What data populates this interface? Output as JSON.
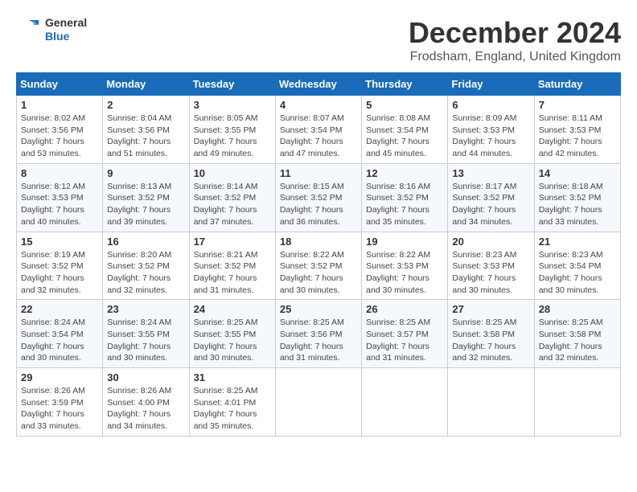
{
  "logo": {
    "text_general": "General",
    "text_blue": "Blue"
  },
  "header": {
    "month": "December 2024",
    "location": "Frodsham, England, United Kingdom"
  },
  "weekdays": [
    "Sunday",
    "Monday",
    "Tuesday",
    "Wednesday",
    "Thursday",
    "Friday",
    "Saturday"
  ],
  "weeks": [
    [
      {
        "day": "1",
        "sunrise": "8:02 AM",
        "sunset": "3:56 PM",
        "daylight": "7 hours and 53 minutes."
      },
      {
        "day": "2",
        "sunrise": "8:04 AM",
        "sunset": "3:56 PM",
        "daylight": "7 hours and 51 minutes."
      },
      {
        "day": "3",
        "sunrise": "8:05 AM",
        "sunset": "3:55 PM",
        "daylight": "7 hours and 49 minutes."
      },
      {
        "day": "4",
        "sunrise": "8:07 AM",
        "sunset": "3:54 PM",
        "daylight": "7 hours and 47 minutes."
      },
      {
        "day": "5",
        "sunrise": "8:08 AM",
        "sunset": "3:54 PM",
        "daylight": "7 hours and 45 minutes."
      },
      {
        "day": "6",
        "sunrise": "8:09 AM",
        "sunset": "3:53 PM",
        "daylight": "7 hours and 44 minutes."
      },
      {
        "day": "7",
        "sunrise": "8:11 AM",
        "sunset": "3:53 PM",
        "daylight": "7 hours and 42 minutes."
      }
    ],
    [
      {
        "day": "8",
        "sunrise": "8:12 AM",
        "sunset": "3:53 PM",
        "daylight": "7 hours and 40 minutes."
      },
      {
        "day": "9",
        "sunrise": "8:13 AM",
        "sunset": "3:52 PM",
        "daylight": "7 hours and 39 minutes."
      },
      {
        "day": "10",
        "sunrise": "8:14 AM",
        "sunset": "3:52 PM",
        "daylight": "7 hours and 37 minutes."
      },
      {
        "day": "11",
        "sunrise": "8:15 AM",
        "sunset": "3:52 PM",
        "daylight": "7 hours and 36 minutes."
      },
      {
        "day": "12",
        "sunrise": "8:16 AM",
        "sunset": "3:52 PM",
        "daylight": "7 hours and 35 minutes."
      },
      {
        "day": "13",
        "sunrise": "8:17 AM",
        "sunset": "3:52 PM",
        "daylight": "7 hours and 34 minutes."
      },
      {
        "day": "14",
        "sunrise": "8:18 AM",
        "sunset": "3:52 PM",
        "daylight": "7 hours and 33 minutes."
      }
    ],
    [
      {
        "day": "15",
        "sunrise": "8:19 AM",
        "sunset": "3:52 PM",
        "daylight": "7 hours and 32 minutes."
      },
      {
        "day": "16",
        "sunrise": "8:20 AM",
        "sunset": "3:52 PM",
        "daylight": "7 hours and 32 minutes."
      },
      {
        "day": "17",
        "sunrise": "8:21 AM",
        "sunset": "3:52 PM",
        "daylight": "7 hours and 31 minutes."
      },
      {
        "day": "18",
        "sunrise": "8:22 AM",
        "sunset": "3:52 PM",
        "daylight": "7 hours and 30 minutes."
      },
      {
        "day": "19",
        "sunrise": "8:22 AM",
        "sunset": "3:53 PM",
        "daylight": "7 hours and 30 minutes."
      },
      {
        "day": "20",
        "sunrise": "8:23 AM",
        "sunset": "3:53 PM",
        "daylight": "7 hours and 30 minutes."
      },
      {
        "day": "21",
        "sunrise": "8:23 AM",
        "sunset": "3:54 PM",
        "daylight": "7 hours and 30 minutes."
      }
    ],
    [
      {
        "day": "22",
        "sunrise": "8:24 AM",
        "sunset": "3:54 PM",
        "daylight": "7 hours and 30 minutes."
      },
      {
        "day": "23",
        "sunrise": "8:24 AM",
        "sunset": "3:55 PM",
        "daylight": "7 hours and 30 minutes."
      },
      {
        "day": "24",
        "sunrise": "8:25 AM",
        "sunset": "3:55 PM",
        "daylight": "7 hours and 30 minutes."
      },
      {
        "day": "25",
        "sunrise": "8:25 AM",
        "sunset": "3:56 PM",
        "daylight": "7 hours and 31 minutes."
      },
      {
        "day": "26",
        "sunrise": "8:25 AM",
        "sunset": "3:57 PM",
        "daylight": "7 hours and 31 minutes."
      },
      {
        "day": "27",
        "sunrise": "8:25 AM",
        "sunset": "3:58 PM",
        "daylight": "7 hours and 32 minutes."
      },
      {
        "day": "28",
        "sunrise": "8:25 AM",
        "sunset": "3:58 PM",
        "daylight": "7 hours and 32 minutes."
      }
    ],
    [
      {
        "day": "29",
        "sunrise": "8:26 AM",
        "sunset": "3:59 PM",
        "daylight": "7 hours and 33 minutes."
      },
      {
        "day": "30",
        "sunrise": "8:26 AM",
        "sunset": "4:00 PM",
        "daylight": "7 hours and 34 minutes."
      },
      {
        "day": "31",
        "sunrise": "8:25 AM",
        "sunset": "4:01 PM",
        "daylight": "7 hours and 35 minutes."
      },
      null,
      null,
      null,
      null
    ]
  ]
}
